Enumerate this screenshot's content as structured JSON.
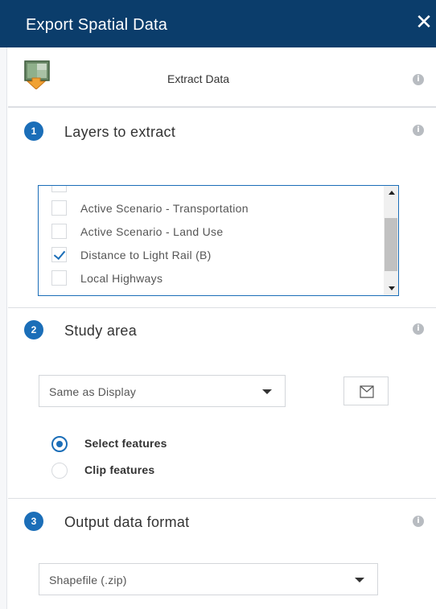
{
  "panel": {
    "title": "Export Spatial Data",
    "close_icon": "close-icon"
  },
  "tool": {
    "label": "Extract Data",
    "icon": "extract-data-icon"
  },
  "info_icon": "i",
  "steps": [
    {
      "number": "1",
      "title": "Layers to extract",
      "layers": [
        {
          "label": "Active Scenario - Transportation",
          "checked": false
        },
        {
          "label": "Active Scenario - Land Use",
          "checked": false
        },
        {
          "label": "Distance to Light Rail (B)",
          "checked": true
        },
        {
          "label": "Local Highways",
          "checked": false
        }
      ]
    },
    {
      "number": "2",
      "title": "Study area",
      "area_select": "Same as Display",
      "draw_icon": "envelope-draw-icon",
      "options": [
        {
          "label": "Select features",
          "selected": true
        },
        {
          "label": "Clip features",
          "selected": false
        }
      ]
    },
    {
      "number": "3",
      "title": "Output data format",
      "format_select": "Shapefile (.zip)"
    }
  ],
  "colors": {
    "header_bg": "#0b3d6b",
    "accent": "#1b6eb8"
  }
}
